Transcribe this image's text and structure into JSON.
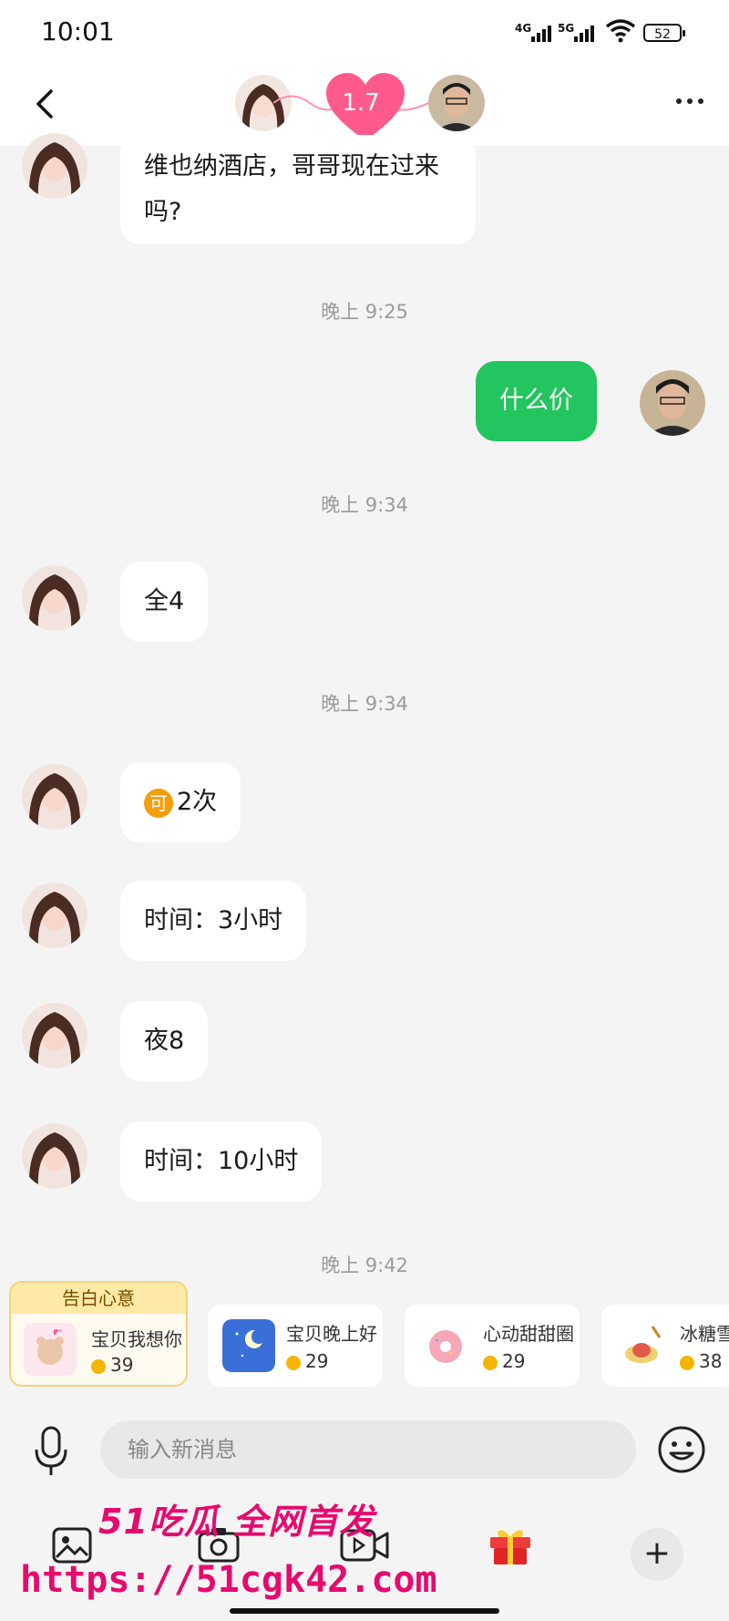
{
  "status_bar": {
    "time": "10:01",
    "signal1_label": "4G",
    "signal2_label": "5G",
    "battery": "52"
  },
  "header": {
    "intimacy_value": "1.7"
  },
  "messages": {
    "m1_text": "维也纳酒店，哥哥现在过来吗?",
    "t1": "晚上 9:25",
    "m2_text": "什么价",
    "t2": "晚上 9:34",
    "m3_text": "全4",
    "t3": "晚上 9:34",
    "m4_badge": "可",
    "m4_text": "2次",
    "m5_text": "时间：3小时",
    "m6_text": "夜8",
    "m7_text": "时间：10小时",
    "t4": "晚上 9:42"
  },
  "gifts": {
    "tag": "告白心意",
    "items": [
      {
        "name": "宝贝我想你",
        "price": "39"
      },
      {
        "name": "宝贝晚上好",
        "price": "29"
      },
      {
        "name": "心动甜甜圈",
        "price": "29"
      },
      {
        "name": "冰糖雪",
        "price": "38"
      }
    ]
  },
  "input": {
    "placeholder": "输入新消息"
  },
  "watermark": {
    "line1": "51吃瓜 全网首发",
    "line2": "https://51cgk42.com"
  },
  "colors": {
    "accent_green": "#22c55e",
    "heart_pink": "#ff5a8c",
    "watermark": "#e60a6e"
  }
}
